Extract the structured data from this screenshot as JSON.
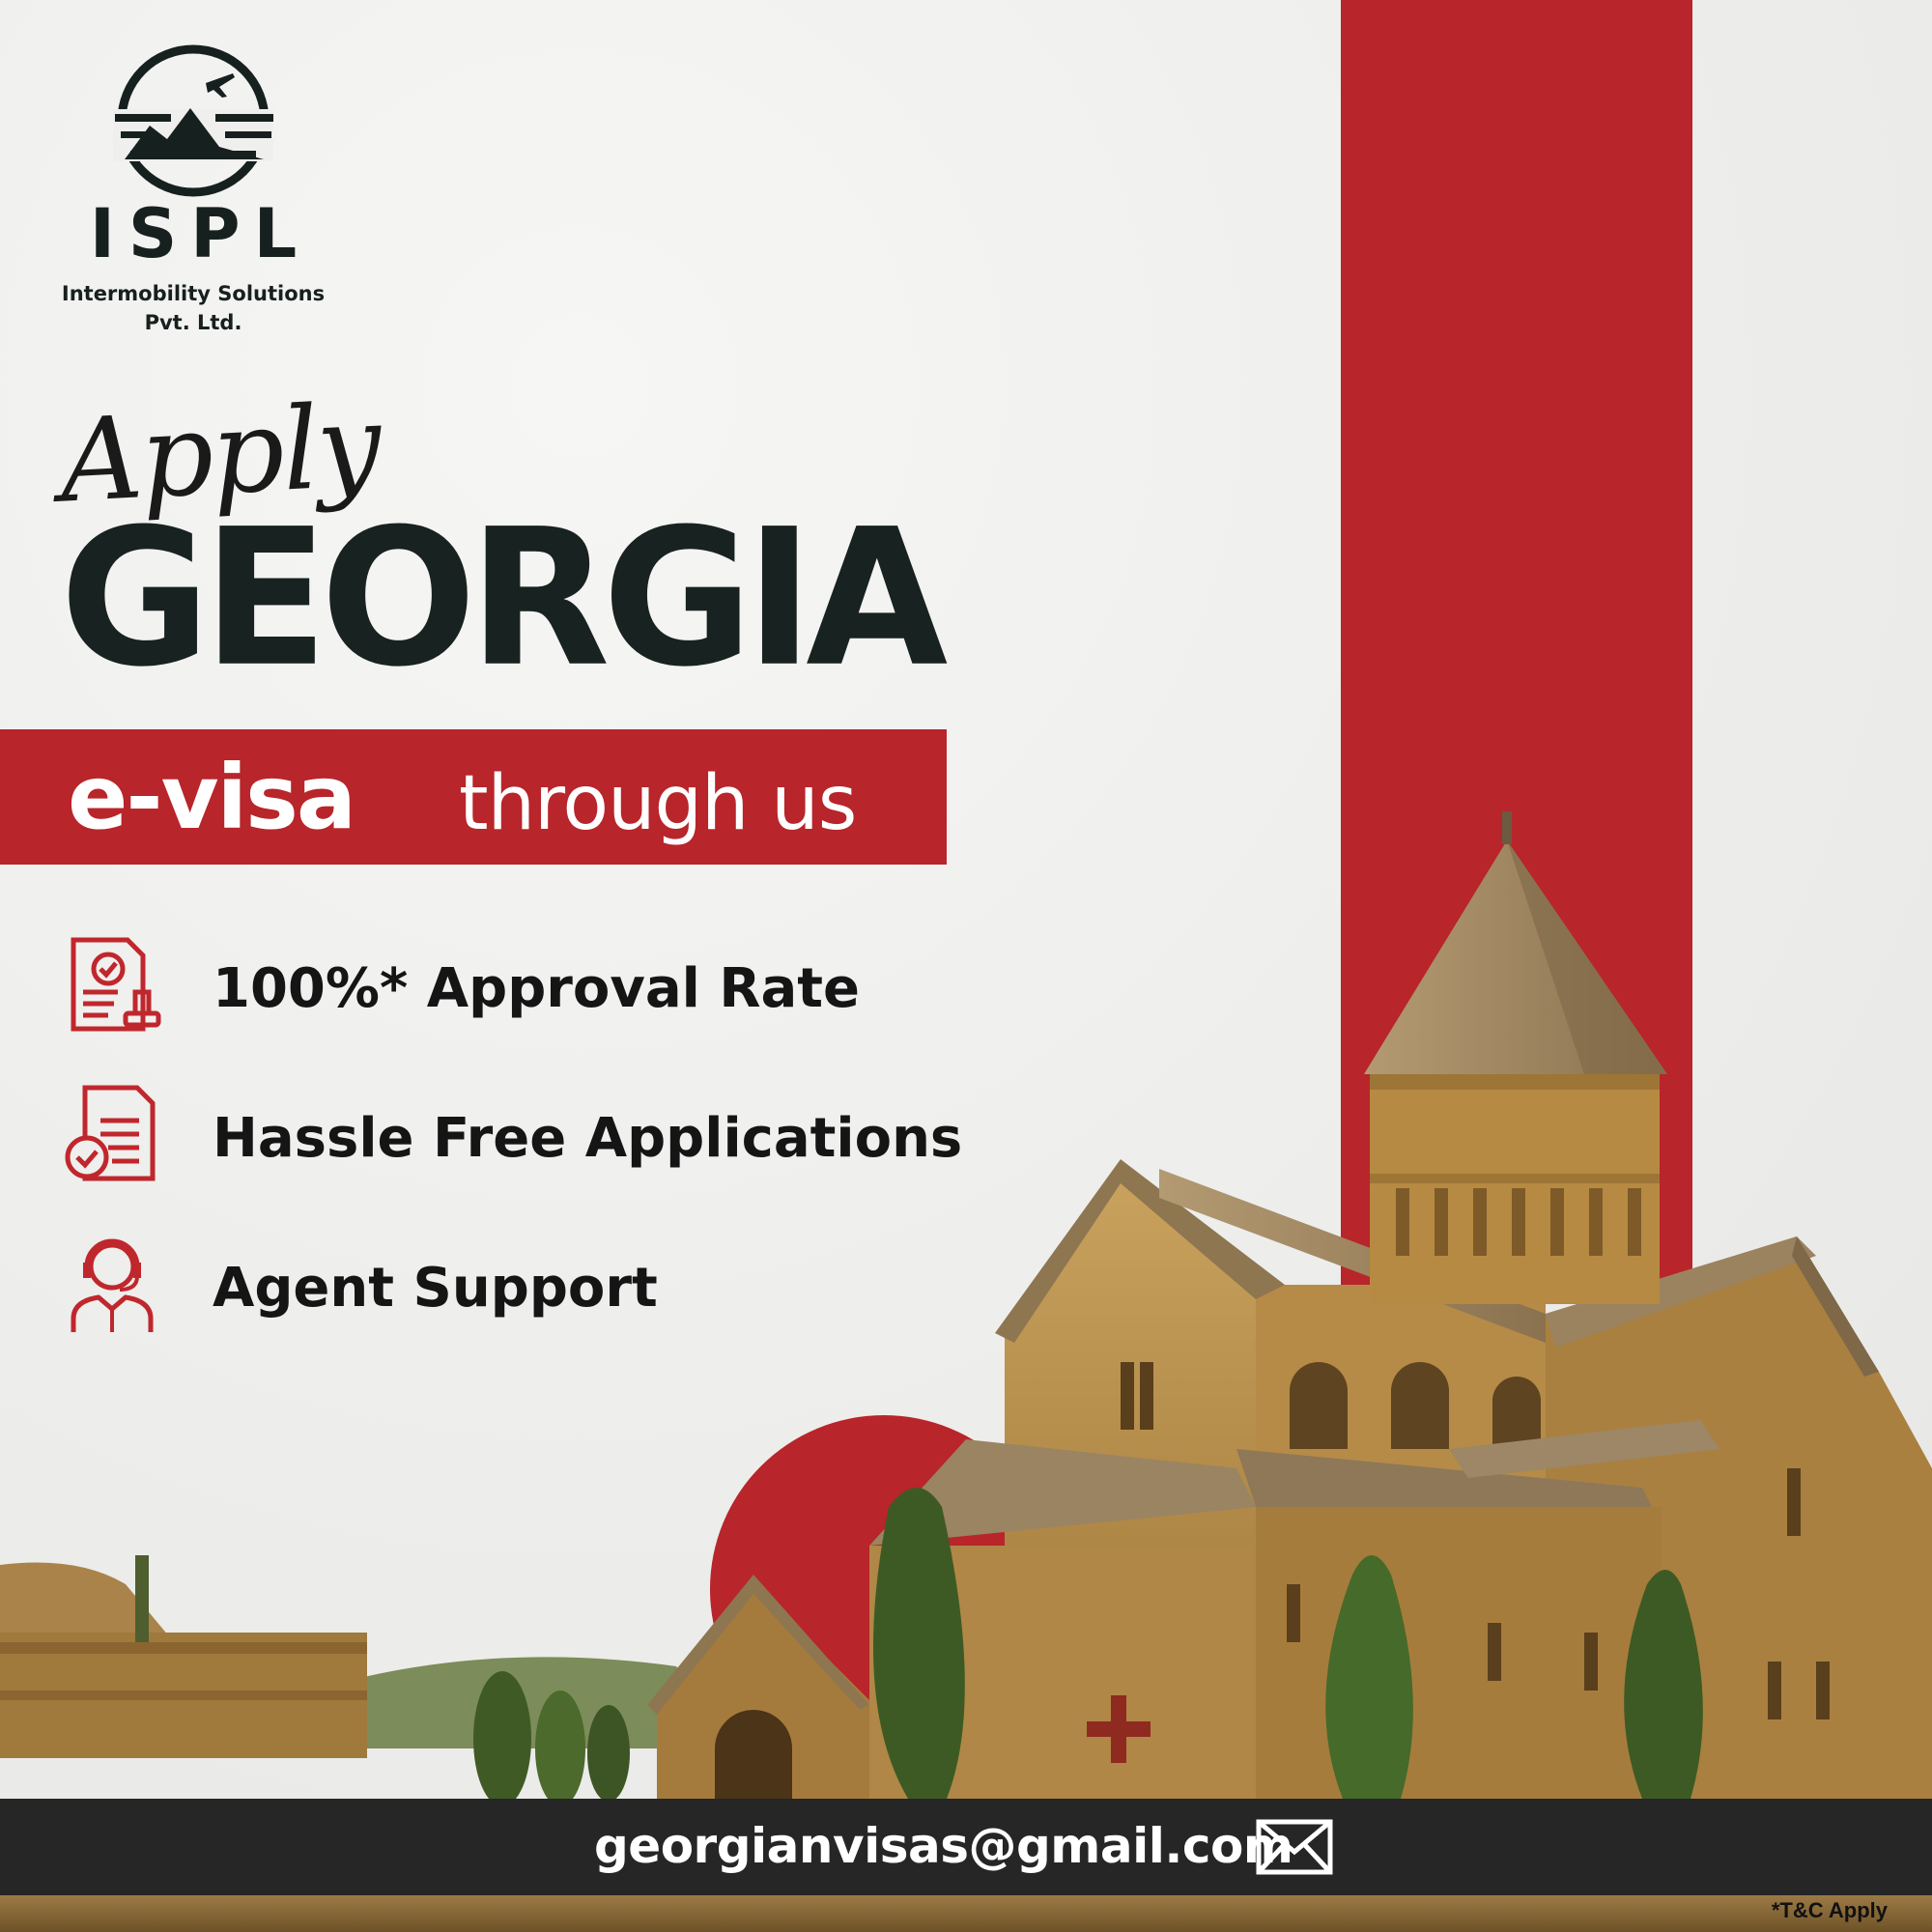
{
  "brand": {
    "name": "ISPL",
    "subtitle_line1": "Intermobility Solutions",
    "subtitle_line2": "Pvt. Ltd."
  },
  "headline": {
    "script": "Apply",
    "country": "GEORGIA",
    "evisa": "e-visa",
    "through": "through us"
  },
  "features": [
    {
      "label": "100%* Approval Rate",
      "icon": "approved-document-stamp-icon"
    },
    {
      "label": "Hassle Free Applications",
      "icon": "document-check-icon"
    },
    {
      "label": "Agent Support",
      "icon": "agent-headset-icon"
    }
  ],
  "footer": {
    "email": "georgianvisas@gmail.com",
    "icon": "envelope-icon"
  },
  "disclaimer": "*T&C Apply",
  "colors": {
    "accent_red": "#b8252a",
    "dark": "#182220",
    "footer_bg": "#252625",
    "background": "#efefed"
  }
}
